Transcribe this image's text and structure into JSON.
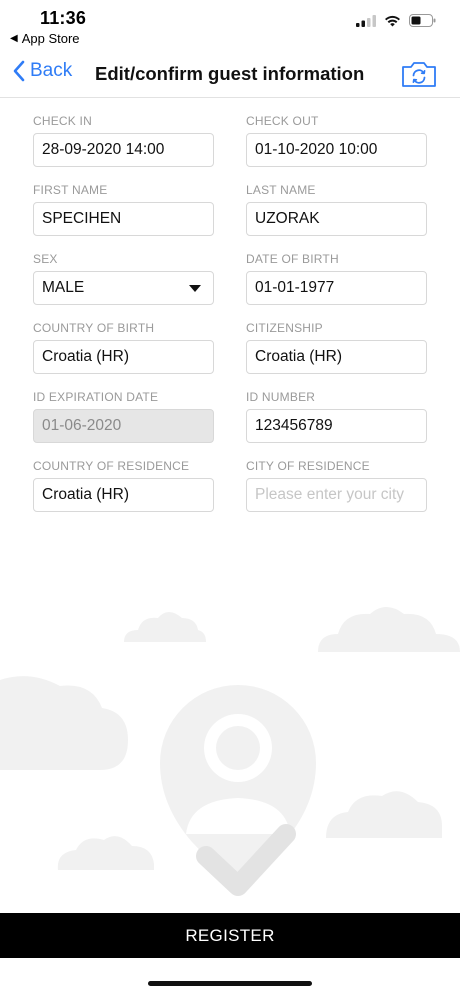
{
  "status_bar": {
    "time": "11:36",
    "back_app": "App Store"
  },
  "nav": {
    "back_label": "Back",
    "title": "Edit/confirm guest information",
    "accent_color": "#2f7cf6"
  },
  "form": {
    "check_in": {
      "label": "CHECK IN",
      "value": "28-09-2020 14:00"
    },
    "check_out": {
      "label": "CHECK OUT",
      "value": "01-10-2020 10:00"
    },
    "first_name": {
      "label": "FIRST NAME",
      "value": "SPECIHEN"
    },
    "last_name": {
      "label": "LAST NAME",
      "value": "UZORAK"
    },
    "sex": {
      "label": "SEX",
      "value": "MALE"
    },
    "date_of_birth": {
      "label": "DATE OF BIRTH",
      "value": "01-01-1977"
    },
    "country_of_birth": {
      "label": "COUNTRY OF BIRTH",
      "value": "Croatia (HR)"
    },
    "citizenship": {
      "label": "CITIZENSHIP",
      "value": "Croatia (HR)"
    },
    "id_expiration_date": {
      "label": "ID EXPIRATION DATE",
      "value": "01-06-2020"
    },
    "id_number": {
      "label": "ID NUMBER",
      "value": "123456789"
    },
    "country_of_residence": {
      "label": "COUNTRY OF RESIDENCE",
      "value": "Croatia (HR)"
    },
    "city_of_residence": {
      "label": "CITY OF RESIDENCE",
      "placeholder": "Please enter your city"
    }
  },
  "register_label": "REGISTER"
}
